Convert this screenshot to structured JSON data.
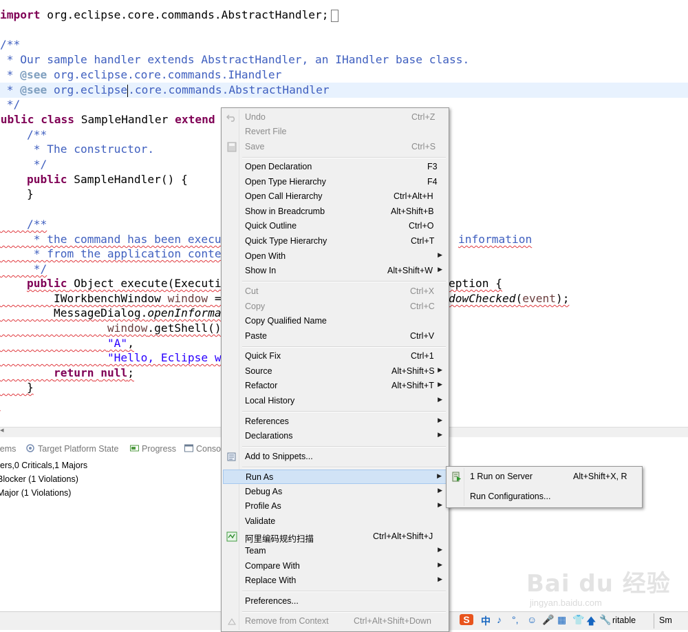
{
  "editor": {
    "code": {
      "import": {
        "kw": "import",
        "rest": " org.eclipse.core.commands.AbstractHandler;"
      },
      "c1_open": "/**",
      "c1_line1": " * Our sample handler extends AbstractHandler, an IHandler base class.",
      "c1_line2_star": " * ",
      "c1_line2_tag": "@see",
      "c1_line2_rest": " org.eclipse.core.commands.IHandler",
      "c1_line3_star": " * ",
      "c1_line3_tag": "@see",
      "c1_line3_a": " org.eclipse",
      "c1_line3_b": ".core.commands.AbstractHandler",
      "c1_close": " */",
      "class_kw1": "public",
      "class_kw2": "class",
      "class_name": " SampleHandler ",
      "class_kw3": "extend",
      "c2_open": "    /**",
      "c2_line1": "     * The constructor.",
      "c2_close": "     */",
      "ctor_kw": "public",
      "ctor_rest": " SampleHandler() {",
      "ctor_close": "    }",
      "c3_open": "    /**",
      "c3_l1_a": "     * the command has been execu",
      "c3_l1_b": "information",
      "c3_l2": "     * from the application conte",
      "c3_close": "     */",
      "exec_kw": "public",
      "exec_rest": " Object execute(Executi",
      "exec_tail": "eption {",
      "win_type": "        IWorkbenchWindow ",
      "win_var": "window",
      "win_eq": " =",
      "win_tail_it": "dowChecked",
      "win_tail_paren": "(",
      "win_tail_var": "event",
      "win_tail_end": ");",
      "msg_a": "        MessageDialog.",
      "msg_it": "openInforma",
      "shell_var": "window",
      "shell_rest": ".getShell()",
      "str_a": "\"A\"",
      "str_comma": ",",
      "str_hello": "\"Hello, Eclipse w",
      "ret_kw": "return",
      "ret_null": "null",
      "ret_end": ";",
      "exec_close": "    }",
      "class_close": "}"
    }
  },
  "bottom_panel": {
    "tabs": [
      "Problems",
      "Target Platform State",
      "Progress",
      "Console"
    ],
    "tabs_visible": [
      "lems",
      "Target Platform State",
      "Progress",
      "Conso"
    ],
    "summary": "ers,0 Criticals,1 Majors",
    "rows": [
      "Blocker (1 Violations)",
      "Major (1 Violations)"
    ]
  },
  "status_bar": {
    "writable": "Writable",
    "writable_visible": "ritable",
    "mode_visible": "Sm"
  },
  "ime": {
    "items": [
      "S",
      "中",
      "♪",
      "°,",
      "☺",
      "🎤",
      "▦",
      "👕",
      "🡅",
      "🔧"
    ]
  },
  "context_menu": {
    "items": [
      {
        "label": "Undo",
        "shortcut": "Ctrl+Z",
        "disabled": true,
        "icon": "undo-icon"
      },
      {
        "label": "Revert File",
        "disabled": true
      },
      {
        "label": "Save",
        "shortcut": "Ctrl+S",
        "disabled": true,
        "icon": "save-icon"
      },
      {
        "label": "Open Declaration",
        "shortcut": "F3"
      },
      {
        "label": "Open Type Hierarchy",
        "shortcut": "F4"
      },
      {
        "label": "Open Call Hierarchy",
        "shortcut": "Ctrl+Alt+H"
      },
      {
        "label": "Show in Breadcrumb",
        "shortcut": "Alt+Shift+B"
      },
      {
        "label": "Quick Outline",
        "shortcut": "Ctrl+O"
      },
      {
        "label": "Quick Type Hierarchy",
        "shortcut": "Ctrl+T"
      },
      {
        "label": "Open With",
        "submenu": true
      },
      {
        "label": "Show In",
        "shortcut": "Alt+Shift+W",
        "submenu": true
      },
      {
        "label": "Cut",
        "shortcut": "Ctrl+X",
        "disabled": true
      },
      {
        "label": "Copy",
        "shortcut": "Ctrl+C",
        "disabled": true
      },
      {
        "label": "Copy Qualified Name"
      },
      {
        "label": "Paste",
        "shortcut": "Ctrl+V"
      },
      {
        "label": "Quick Fix",
        "shortcut": "Ctrl+1"
      },
      {
        "label": "Source",
        "shortcut": "Alt+Shift+S",
        "submenu": true
      },
      {
        "label": "Refactor",
        "shortcut": "Alt+Shift+T",
        "submenu": true
      },
      {
        "label": "Local History",
        "submenu": true
      },
      {
        "label": "References",
        "submenu": true
      },
      {
        "label": "Declarations",
        "submenu": true
      },
      {
        "label": "Add to Snippets...",
        "icon": "snippets-icon"
      },
      {
        "label": "Run As",
        "submenu": true,
        "selected": true
      },
      {
        "label": "Debug As",
        "submenu": true
      },
      {
        "label": "Profile As",
        "submenu": true
      },
      {
        "label": "Validate"
      },
      {
        "label": "阿里编码规约扫描",
        "shortcut": "Ctrl+Alt+Shift+J",
        "icon": "p3c-scan-icon"
      },
      {
        "label": "Team",
        "submenu": true
      },
      {
        "label": "Compare With",
        "submenu": true
      },
      {
        "label": "Replace With",
        "submenu": true
      },
      {
        "label": "Preferences..."
      },
      {
        "label": "Remove from Context",
        "shortcut": "Ctrl+Alt+Shift+Down",
        "disabled": true,
        "icon": "remove-context-icon"
      }
    ]
  },
  "run_as_submenu": {
    "items": [
      {
        "label": "1 Run on Server",
        "shortcut": "Alt+Shift+X, R",
        "icon": "run-server-icon"
      },
      {
        "label": "Run Configurations..."
      }
    ]
  },
  "watermark": {
    "main": "Bai du 经验",
    "sub": "jingyan.baidu.com"
  }
}
